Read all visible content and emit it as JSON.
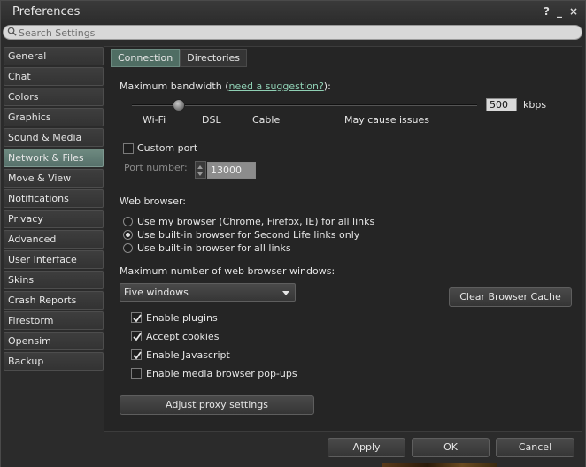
{
  "window": {
    "title": "Preferences",
    "help_label": "?",
    "minimize_label": "_",
    "close_label": "×"
  },
  "search": {
    "placeholder": "Search Settings"
  },
  "sidebar": {
    "items": [
      {
        "label": "General"
      },
      {
        "label": "Chat"
      },
      {
        "label": "Colors"
      },
      {
        "label": "Graphics"
      },
      {
        "label": "Sound & Media"
      },
      {
        "label": "Network & Files",
        "selected": true
      },
      {
        "label": "Move & View"
      },
      {
        "label": "Notifications"
      },
      {
        "label": "Privacy"
      },
      {
        "label": "Advanced"
      },
      {
        "label": "User Interface"
      },
      {
        "label": "Skins"
      },
      {
        "label": "Crash Reports"
      },
      {
        "label": "Firestorm"
      },
      {
        "label": "Opensim"
      },
      {
        "label": "Backup"
      }
    ]
  },
  "tabs": [
    {
      "label": "Connection",
      "active": true
    },
    {
      "label": "Directories"
    }
  ],
  "connection": {
    "bandwidth_label_prefix": "Maximum bandwidth (",
    "bandwidth_link": "need a suggestion?",
    "bandwidth_label_suffix": "):",
    "bandwidth_value": "500",
    "bandwidth_unit": "kbps",
    "slider_marks": {
      "wifi": "Wi-Fi",
      "dsl": "DSL",
      "cable": "Cable",
      "issues": "May cause issues"
    },
    "custom_port_label": "Custom port",
    "custom_port_checked": false,
    "port_number_label": "Port number:",
    "port_number_value": "13000",
    "web_browser_label": "Web browser:",
    "browser_options": [
      {
        "label": "Use my browser (Chrome, Firefox, IE) for all links",
        "selected": false
      },
      {
        "label": "Use built-in browser for Second Life links only",
        "selected": true
      },
      {
        "label": "Use built-in browser for all links",
        "selected": false
      }
    ],
    "max_windows_label": "Maximum number of web browser windows:",
    "max_windows_value": "Five windows",
    "clear_cache_label": "Clear Browser Cache",
    "checkboxes": [
      {
        "label": "Enable plugins",
        "checked": true
      },
      {
        "label": "Accept cookies",
        "checked": true
      },
      {
        "label": "Enable Javascript",
        "checked": true
      },
      {
        "label": "Enable media browser pop-ups",
        "checked": false
      }
    ],
    "proxy_label": "Adjust proxy settings"
  },
  "footer": {
    "apply_label": "Apply",
    "ok_label": "OK",
    "cancel_label": "Cancel"
  }
}
